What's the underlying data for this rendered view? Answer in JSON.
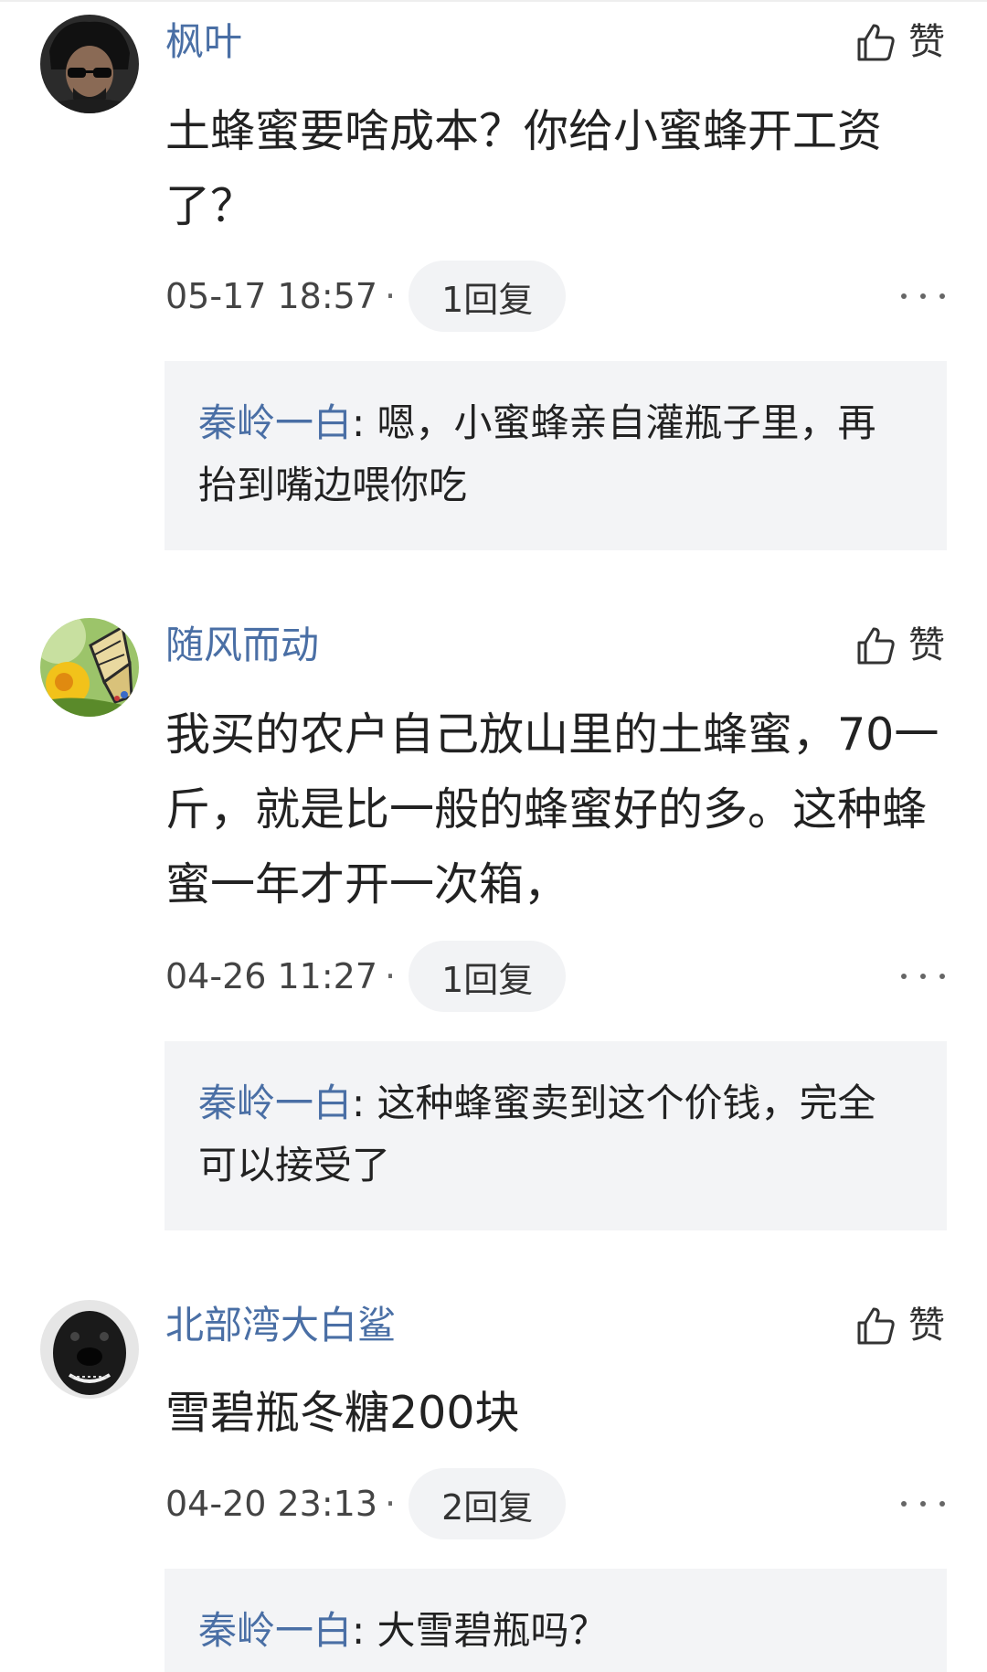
{
  "like_label": "赞",
  "more_icon": "more-horizontal-icon",
  "like_icon": "thumbs-up-icon",
  "colors": {
    "username": "#4a6fa5",
    "reply_box_bg": "#f3f4f6",
    "pill_bg": "#f2f3f5"
  },
  "comments": [
    {
      "username": "枫叶",
      "content": "土蜂蜜要啥成本？你给小蜜蜂开工资了？",
      "timestamp": "05-17 18:57",
      "separator": "·",
      "reply_count": "1回复",
      "reply": {
        "author": "秦岭一白",
        "text": ": 嗯，小蜜蜂亲自灌瓶子里，再抬到嘴边喂你吃"
      }
    },
    {
      "username": "随风而动",
      "content": "我买的农户自己放山里的土蜂蜜，70一斤，就是比一般的蜂蜜好的多。这种蜂蜜一年才开一次箱，",
      "timestamp": "04-26 11:27",
      "separator": "·",
      "reply_count": "1回复",
      "reply": {
        "author": "秦岭一白",
        "text": ": 这种蜂蜜卖到这个价钱，完全可以接受了"
      }
    },
    {
      "username": "北部湾大白鲨",
      "content": "雪碧瓶冬糖200块",
      "timestamp": "04-20 23:13",
      "separator": "·",
      "reply_count": "2回复",
      "reply": {
        "author": "秦岭一白",
        "text": ": 大雪碧瓶吗？"
      }
    }
  ]
}
